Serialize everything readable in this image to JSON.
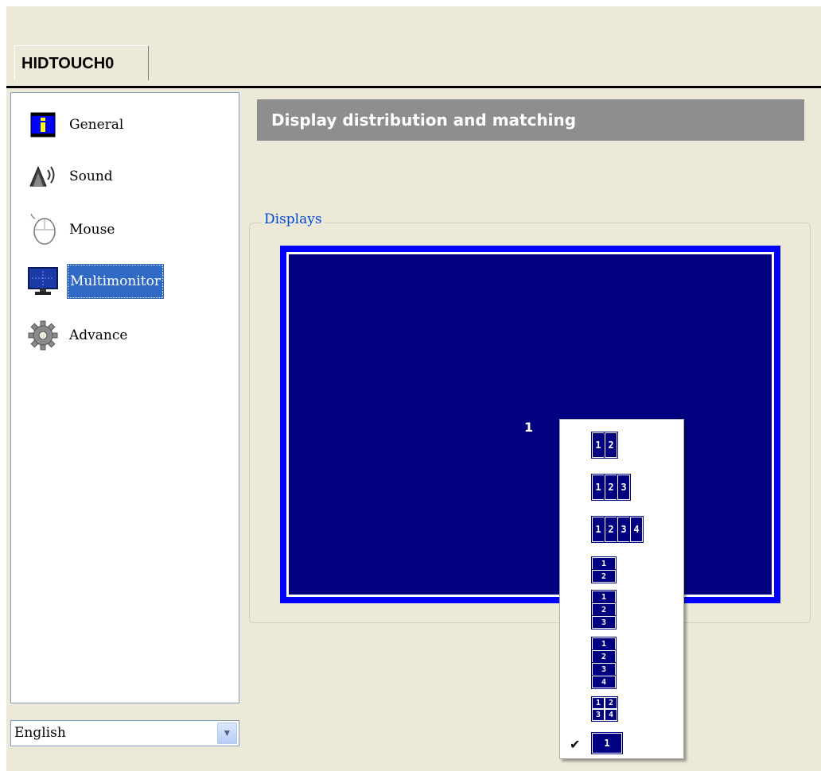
{
  "device_tab": "HIDTOUCH0",
  "sidebar": {
    "items": [
      {
        "label": "General",
        "icon": "info-icon"
      },
      {
        "label": "Sound",
        "icon": "speaker-icon"
      },
      {
        "label": "Mouse",
        "icon": "mouse-icon"
      },
      {
        "label": "Multimonitor",
        "icon": "monitor-icon",
        "selected": true
      },
      {
        "label": "Advance",
        "icon": "gear-icon"
      }
    ]
  },
  "language": {
    "selected": "English"
  },
  "panel": {
    "header": "Display distribution and matching",
    "group_title": "Displays",
    "display_number": "1"
  },
  "layout_menu": {
    "options": [
      {
        "layout": "horizontal",
        "labels": [
          "1",
          "2"
        ]
      },
      {
        "layout": "horizontal",
        "labels": [
          "1",
          "2",
          "3"
        ]
      },
      {
        "layout": "horizontal",
        "labels": [
          "1",
          "2",
          "3",
          "4"
        ]
      },
      {
        "layout": "vertical",
        "labels": [
          "1",
          "2"
        ]
      },
      {
        "layout": "vertical",
        "labels": [
          "1",
          "2",
          "3"
        ]
      },
      {
        "layout": "vertical",
        "labels": [
          "1",
          "2",
          "3",
          "4"
        ]
      },
      {
        "layout": "grid",
        "labels": [
          "1",
          "2",
          "3",
          "4"
        ]
      },
      {
        "layout": "single",
        "labels": [
          "1"
        ],
        "checked": true
      }
    ],
    "check_glyph": "✔"
  },
  "colors": {
    "accent": "#316ac5",
    "display_bg": "#000080",
    "display_border": "#0000ff",
    "header_bg": "#8e8e8e"
  }
}
